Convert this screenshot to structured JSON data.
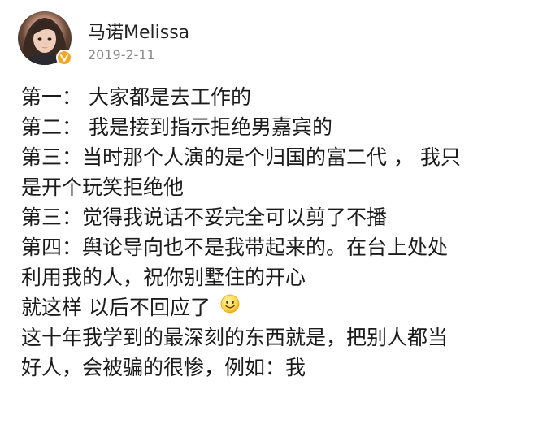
{
  "post": {
    "author": "马诺Melissa",
    "date": "2019-2-11",
    "verified_color": "#f5a623",
    "lines": [
      "第一：  大家都是去工作的",
      "第二：  我是接到指示拒绝男嘉宾的",
      "第三：当时那个人演的是个归国的富二代 ， 我只",
      "是开个玩笑拒绝他",
      "第三：觉得我说话不妥完全可以剪了不播",
      "第四：舆论导向也不是我带起来的。在台上处处",
      "利用我的人，祝你别墅住的开心",
      "就这样 以后不回应了",
      "这十年我学到的最深刻的东西就是，把别人都当",
      "好人，会被骗的很惨，例如：我"
    ],
    "emoji_icon": "smiley-emoji-icon"
  }
}
